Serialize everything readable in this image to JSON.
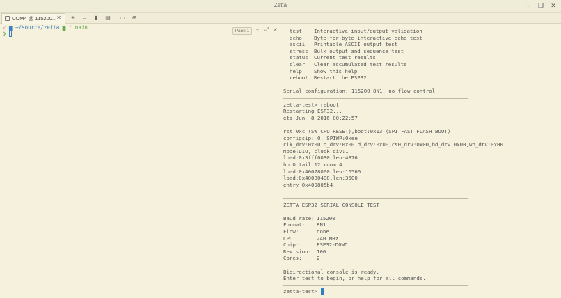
{
  "window": {
    "title": "Zetta"
  },
  "tab": {
    "label": "COM4 @ 115200..."
  },
  "left_pane": {
    "path": "~/source/zetta",
    "branch": "main",
    "prompt_symbol": "❯",
    "pane_badge": "Pane 1"
  },
  "terminal": {
    "commands": [
      {
        "cmd": "test",
        "desc": "Interactive input/output validation"
      },
      {
        "cmd": "echo",
        "desc": "Byte-for-byte interactive echo test"
      },
      {
        "cmd": "ascii",
        "desc": "Printable ASCII output test"
      },
      {
        "cmd": "stress",
        "desc": "Bulk output and sequence test"
      },
      {
        "cmd": "status",
        "desc": "Current test results"
      },
      {
        "cmd": "clear",
        "desc": "Clear accumulated test results"
      },
      {
        "cmd": "help",
        "desc": "Show this help"
      },
      {
        "cmd": "reboot",
        "desc": "Restart the ESP32"
      }
    ],
    "serial_config": "Serial configuration: 115200 8N1, no flow control",
    "reboot_cmd": "zetta-test> reboot",
    "restarting": "Restarting ESP32...",
    "ets": "ets Jun  8 2016 00:22:57",
    "boot_lines": [
      "rst:0xc (SW_CPU_RESET),boot:0x13 (SPI_FAST_FLASH_BOOT)",
      "configsip: 0, SPIWP:0xee",
      "clk_drv:0x00,q_drv:0x00,d_drv:0x00,cs0_drv:0x00,hd_drv:0x00,wp_drv:0x00",
      "mode:DIO, clock div:1",
      "load:0x3fff0030,len:4876",
      "ho 0 tail 12 room 4",
      "load:0x40078000,len:16560",
      "load:0x40080400,len:3500",
      "entry 0x400805b4"
    ],
    "banner": "ZETTA ESP32 SERIAL CONSOLE TEST",
    "info": [
      {
        "key": "Baud rate:",
        "value": "115200"
      },
      {
        "key": "Format:",
        "value": "8N1"
      },
      {
        "key": "Flow:",
        "value": "none"
      },
      {
        "key": "CPU:",
        "value": "240 MHz"
      },
      {
        "key": "Chip:",
        "value": "ESP32-D0WD"
      },
      {
        "key": "Revision:",
        "value": "100"
      },
      {
        "key": "Cores:",
        "value": "2"
      }
    ],
    "ready_1": "Bidirectional console is ready.",
    "ready_2": "Enter test to begin, or help for all commands.",
    "prompt": "zetta-test>"
  }
}
